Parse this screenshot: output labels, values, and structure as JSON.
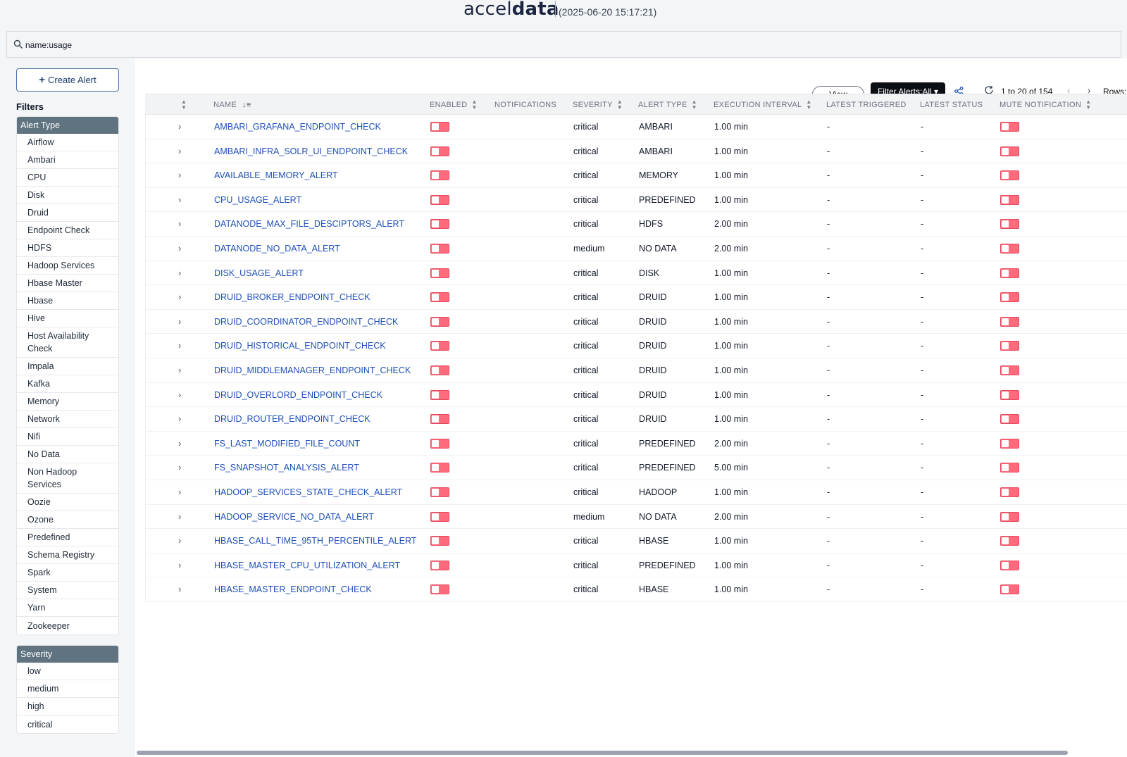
{
  "header": {
    "brand_light": "accel",
    "brand_bold": "data",
    "timestamp": "(2025-06-20 15:17:21)"
  },
  "search": {
    "value": "name:usage",
    "icon": "search-icon"
  },
  "sidebar": {
    "create_label": "Create Alert",
    "filters_title": "Filters",
    "alert_type_title": "Alert Type",
    "alert_types": [
      "Airflow",
      "Ambari",
      "CPU",
      "Disk",
      "Druid",
      "Endpoint Check",
      "HDFS",
      "Hadoop Services",
      "Hbase Master",
      "Hbase",
      "Hive",
      "Host Availability Check",
      "Impala",
      "Kafka",
      "Memory",
      "Network",
      "Nifi",
      "No Data",
      "Non Hadoop Services",
      "Oozie",
      "Ozone",
      "Predefined",
      "Schema Registry",
      "Spark",
      "System",
      "Yarn",
      "Zookeeper"
    ],
    "severity_title": "Severity",
    "severities": [
      "low",
      "medium",
      "high",
      "critical"
    ]
  },
  "toolbar": {
    "view_label": "View",
    "filter_label": "Filter Alerts:All ▾",
    "pager_text": "1 to 20 of 154",
    "rows_label": "Rows:"
  },
  "table": {
    "columns": {
      "name": "NAME",
      "enabled": "ENABLED",
      "notifications": "NOTIFICATIONS",
      "severity": "SEVERITY",
      "alert_type": "ALERT TYPE",
      "interval": "EXECUTION INTERVAL",
      "latest_triggered": "LATEST TRIGGERED",
      "latest_status": "LATEST STATUS",
      "mute": "MUTE NOTIFICATION"
    },
    "rows": [
      {
        "name": "AMBARI_GRAFANA_ENDPOINT_CHECK",
        "severity": "critical",
        "type": "AMBARI",
        "interval": "1.00 min",
        "triggered": "-",
        "status": "-"
      },
      {
        "name": "AMBARI_INFRA_SOLR_UI_ENDPOINT_CHECK",
        "severity": "critical",
        "type": "AMBARI",
        "interval": "1.00 min",
        "triggered": "-",
        "status": "-"
      },
      {
        "name": "AVAILABLE_MEMORY_ALERT",
        "severity": "critical",
        "type": "MEMORY",
        "interval": "1.00 min",
        "triggered": "-",
        "status": "-"
      },
      {
        "name": "CPU_USAGE_ALERT",
        "severity": "critical",
        "type": "PREDEFINED",
        "interval": "1.00 min",
        "triggered": "-",
        "status": "-"
      },
      {
        "name": "DATANODE_MAX_FILE_DESCIPTORS_ALERT",
        "severity": "critical",
        "type": "HDFS",
        "interval": "2.00 min",
        "triggered": "-",
        "status": "-"
      },
      {
        "name": "DATANODE_NO_DATA_ALERT",
        "severity": "medium",
        "type": "NO DATA",
        "interval": "2.00 min",
        "triggered": "-",
        "status": "-"
      },
      {
        "name": "DISK_USAGE_ALERT",
        "severity": "critical",
        "type": "DISK",
        "interval": "1.00 min",
        "triggered": "-",
        "status": "-"
      },
      {
        "name": "DRUID_BROKER_ENDPOINT_CHECK",
        "severity": "critical",
        "type": "DRUID",
        "interval": "1.00 min",
        "triggered": "-",
        "status": "-"
      },
      {
        "name": "DRUID_COORDINATOR_ENDPOINT_CHECK",
        "severity": "critical",
        "type": "DRUID",
        "interval": "1.00 min",
        "triggered": "-",
        "status": "-"
      },
      {
        "name": "DRUID_HISTORICAL_ENDPOINT_CHECK",
        "severity": "critical",
        "type": "DRUID",
        "interval": "1.00 min",
        "triggered": "-",
        "status": "-"
      },
      {
        "name": "DRUID_MIDDLEMANAGER_ENDPOINT_CHECK",
        "severity": "critical",
        "type": "DRUID",
        "interval": "1.00 min",
        "triggered": "-",
        "status": "-"
      },
      {
        "name": "DRUID_OVERLORD_ENDPOINT_CHECK",
        "severity": "critical",
        "type": "DRUID",
        "interval": "1.00 min",
        "triggered": "-",
        "status": "-"
      },
      {
        "name": "DRUID_ROUTER_ENDPOINT_CHECK",
        "severity": "critical",
        "type": "DRUID",
        "interval": "1.00 min",
        "triggered": "-",
        "status": "-"
      },
      {
        "name": "FS_LAST_MODIFIED_FILE_COUNT",
        "severity": "critical",
        "type": "PREDEFINED",
        "interval": "2.00 min",
        "triggered": "-",
        "status": "-"
      },
      {
        "name": "FS_SNAPSHOT_ANALYSIS_ALERT",
        "severity": "critical",
        "type": "PREDEFINED",
        "interval": "5.00 min",
        "triggered": "-",
        "status": "-"
      },
      {
        "name": "HADOOP_SERVICES_STATE_CHECK_ALERT",
        "severity": "critical",
        "type": "HADOOP",
        "interval": "1.00 min",
        "triggered": "-",
        "status": "-"
      },
      {
        "name": "HADOOP_SERVICE_NO_DATA_ALERT",
        "severity": "medium",
        "type": "NO DATA",
        "interval": "2.00 min",
        "triggered": "-",
        "status": "-"
      },
      {
        "name": "HBASE_CALL_TIME_95TH_PERCENTILE_ALERT",
        "severity": "critical",
        "type": "HBASE",
        "interval": "1.00 min",
        "triggered": "-",
        "status": "-"
      },
      {
        "name": "HBASE_MASTER_CPU_UTILIZATION_ALERT",
        "severity": "critical",
        "type": "PREDEFINED",
        "interval": "1.00 min",
        "triggered": "-",
        "status": "-"
      },
      {
        "name": "HBASE_MASTER_ENDPOINT_CHECK",
        "severity": "critical",
        "type": "HBASE",
        "interval": "1.00 min",
        "triggered": "-",
        "status": "-"
      }
    ]
  },
  "colors": {
    "accent": "#1d4fb8",
    "toggle": "#ff6b7d",
    "filter_header": "#5f7380",
    "filter_button": "#0b0f14"
  }
}
